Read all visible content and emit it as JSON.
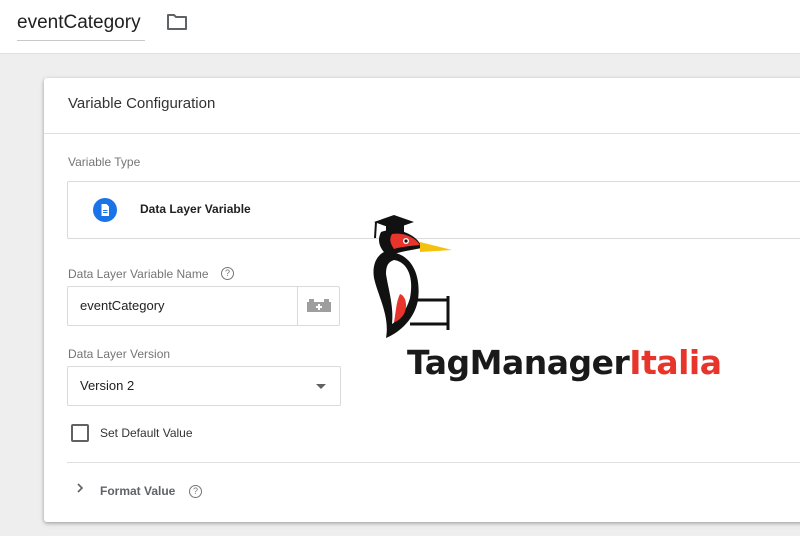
{
  "header": {
    "variable_name": "eventCategory",
    "folder_icon": "folder-icon"
  },
  "card": {
    "title": "Variable Configuration",
    "variable_type_label": "Variable Type",
    "variable_type": {
      "name": "Data Layer Variable",
      "icon": "document-icon",
      "icon_color": "#1a73e8"
    },
    "dlv_name_label": "Data Layer Variable Name",
    "dlv_name_value": "eventCategory",
    "dlv_version_label": "Data Layer Version",
    "dlv_version_value": "Version 2",
    "default_value_label": "Set Default Value",
    "default_value_checked": false,
    "format_value_label": "Format Value"
  },
  "watermark": {
    "brand_part1": "TagManager",
    "brand_part2": "Italia",
    "accent": "#e8352b"
  }
}
